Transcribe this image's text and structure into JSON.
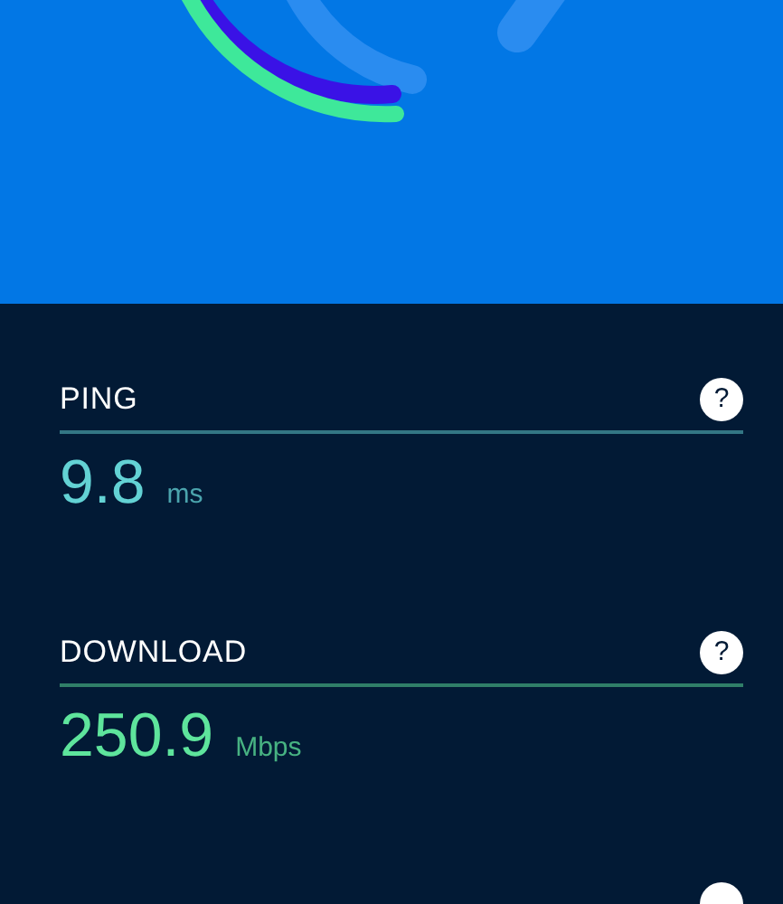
{
  "metrics": [
    {
      "label": "PING",
      "value": "9.8",
      "unit": "ms",
      "help": "?",
      "color": "#63d2d4"
    },
    {
      "label": "DOWNLOAD",
      "value": "250.9",
      "unit": "Mbps",
      "help": "?",
      "color": "#5ee49c"
    }
  ],
  "next_metric": {
    "kind": "cut_off"
  }
}
